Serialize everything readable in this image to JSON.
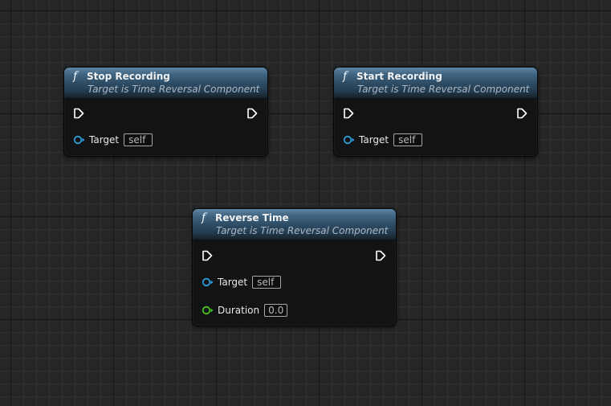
{
  "nodes": {
    "stop_recording": {
      "title": "Stop Recording",
      "subtitle": "Target is Time Reversal Component",
      "target_label": "Target",
      "target_value": "self"
    },
    "start_recording": {
      "title": "Start Recording",
      "subtitle": "Target is Time Reversal Component",
      "target_label": "Target",
      "target_value": "self"
    },
    "reverse_time": {
      "title": "Reverse Time",
      "subtitle": "Target is Time Reversal Component",
      "target_label": "Target",
      "target_value": "self",
      "duration_label": "Duration",
      "duration_value": "0.0"
    }
  },
  "icons": {
    "function": "f",
    "exec_pin": "exec-pin-icon",
    "object_pin": "object-pin-icon",
    "float_pin": "float-pin-icon"
  },
  "colors": {
    "object_pin": "#2f9bd9",
    "float_pin": "#47c21f",
    "exec_pin": "#ffffff",
    "header_top": "#5f87a4",
    "header_bottom": "#1a2b39",
    "node_body": "#111314",
    "grid_background": "#262626"
  }
}
